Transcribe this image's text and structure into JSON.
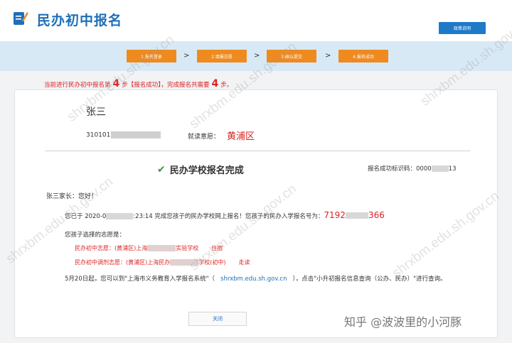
{
  "header": {
    "title": "民办初中报名",
    "policy_button": "政策说明"
  },
  "steps": [
    {
      "label": "1.报名登录"
    },
    {
      "label": "2.填报志愿"
    },
    {
      "label": "3.确认提交"
    },
    {
      "label": "4.报名成功"
    }
  ],
  "step_arrow": ">",
  "notice": {
    "prefix": "当前进行民办初中报名第",
    "current_step": "4",
    "mid": "步【报名成功】，完成报名共需要",
    "total_steps": "4",
    "suffix": "步。"
  },
  "student": {
    "name": "张三",
    "id_prefix": "310101",
    "intent_label": "就读意愿：",
    "intent_value": "黄浦区"
  },
  "result": {
    "title": "民办学校报名完成",
    "code_label": "报名成功标识码：",
    "code_prefix": "0000",
    "code_suffix": "13"
  },
  "letter": {
    "greeting": "张三家长：您好！",
    "line1_prefix": "您已于 2020-0",
    "line1_time": ":23:14 完成您孩子的民办学校网上报名！您孩子的民办入学报名号为：",
    "reg_prefix": "7192",
    "reg_suffix": "366",
    "pref_title": "您孩子选择的志愿是：",
    "pref1_prefix": "民办初中志愿：(黄浦区)上海",
    "pref1_suffix": "实验学校",
    "pref1_tag": "住宿",
    "pref2_prefix": "民办初中调剂志愿：(黄浦区)上海民办",
    "pref2_suffix": "学校(初中)",
    "pref2_tag": "走读",
    "may20_prefix": "5月20日起，您可以到\"上海市义务教育入学报名系统\"（",
    "may20_link": "shrxbm.edu.sh.gov.cn",
    "may20_suffix": "），点击\"小升初报名信息查询（公办、民办）\"进行查询。",
    "close_button": "关闭"
  },
  "watermark": "shrxbm.edu.sh.gov.cn",
  "credit": "知乎 @波波里的小河豚",
  "colors": {
    "brand_blue": "#1f6fb8",
    "step_orange": "#ef8a1e",
    "alert_red": "#dd2222",
    "step_bar_bg": "#d8e9f6",
    "check_green": "#3a9a3a"
  }
}
